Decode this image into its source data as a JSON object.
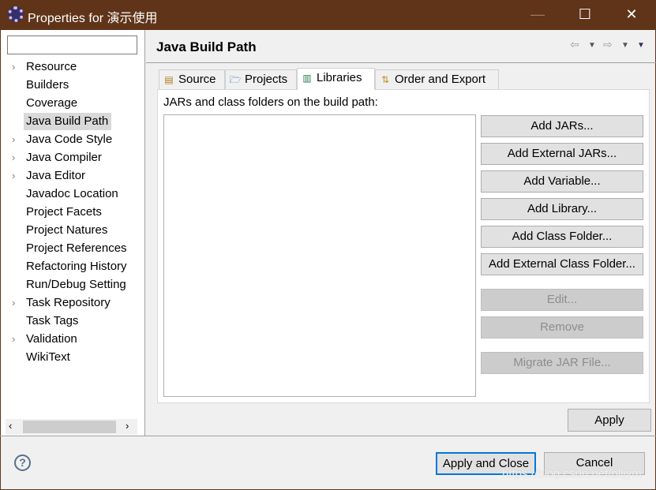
{
  "window": {
    "title": "Properties for 演示使用",
    "minimize": "—",
    "maximize": "☐",
    "close": "✕"
  },
  "sidebar": {
    "filter_value": "",
    "items": [
      {
        "label": "Resource",
        "expandable": true
      },
      {
        "label": "Builders",
        "expandable": false
      },
      {
        "label": "Coverage",
        "expandable": false
      },
      {
        "label": "Java Build Path",
        "expandable": false,
        "selected": true
      },
      {
        "label": "Java Code Style",
        "expandable": true
      },
      {
        "label": "Java Compiler",
        "expandable": true
      },
      {
        "label": "Java Editor",
        "expandable": true
      },
      {
        "label": "Javadoc Location",
        "expandable": false
      },
      {
        "label": "Project Facets",
        "expandable": false
      },
      {
        "label": "Project Natures",
        "expandable": false
      },
      {
        "label": "Project References",
        "expandable": false
      },
      {
        "label": "Refactoring History",
        "expandable": false
      },
      {
        "label": "Run/Debug Setting",
        "expandable": false
      },
      {
        "label": "Task Repository",
        "expandable": true
      },
      {
        "label": "Task Tags",
        "expandable": false
      },
      {
        "label": "Validation",
        "expandable": true
      },
      {
        "label": "WikiText",
        "expandable": false
      }
    ]
  },
  "page": {
    "title": "Java Build Path",
    "tabs": [
      {
        "label": "Source",
        "icon": "source-folder-icon"
      },
      {
        "label": "Projects",
        "icon": "folder-open-icon"
      },
      {
        "label": "Libraries",
        "icon": "library-icon",
        "active": true
      },
      {
        "label": "Order and Export",
        "icon": "order-export-icon"
      }
    ],
    "list_label": "JARs and class folders on the build path:",
    "buttons": [
      {
        "label": "Add JARs...",
        "enabled": true
      },
      {
        "label": "Add External JARs...",
        "enabled": true
      },
      {
        "label": "Add Variable...",
        "enabled": true
      },
      {
        "label": "Add Library...",
        "enabled": true
      },
      {
        "label": "Add Class Folder...",
        "enabled": true
      },
      {
        "label": "Add External Class Folder...",
        "enabled": true
      },
      {
        "label": "Edit...",
        "enabled": false
      },
      {
        "label": "Remove",
        "enabled": false
      },
      {
        "label": "Migrate JAR File...",
        "enabled": false
      }
    ],
    "apply": "Apply"
  },
  "footer": {
    "apply_close": "Apply and Close",
    "cancel": "Cancel"
  },
  "watermark": "https://blog.csdn.net/blljym",
  "colors": {
    "titlebar": "#5f3418",
    "focus": "#0078d7"
  }
}
